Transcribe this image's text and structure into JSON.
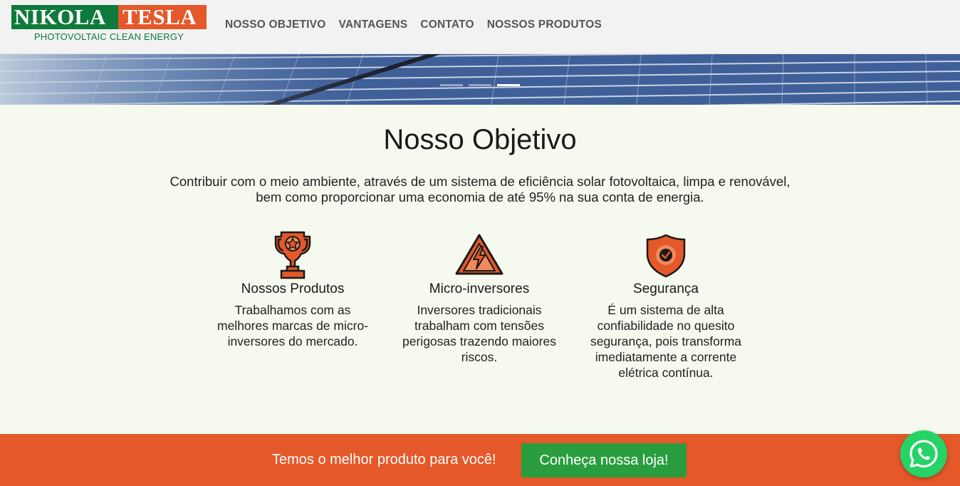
{
  "logo": {
    "name_left": "NIKOLA",
    "name_right": "TESLA",
    "tagline": "PHOTOVOLTAIC CLEAN ENERGY",
    "colors": {
      "green": "#0e7a3b",
      "orange": "#e4582a"
    }
  },
  "nav": {
    "items": [
      {
        "label": "NOSSO OBJETIVO"
      },
      {
        "label": "VANTAGENS"
      },
      {
        "label": "CONTATO"
      },
      {
        "label": "NOSSOS PRODUTOS"
      }
    ]
  },
  "hero": {
    "image": "solar-panels-banner",
    "slides": 3,
    "active_slide": 3
  },
  "main": {
    "title": "Nosso Objetivo",
    "intro_line1": "Contribuir com o meio ambiente, através de um sistema de eficiência solar fotovoltaica, limpa e renovável,",
    "intro_line2": "bem como proporcionar uma economia de até 95% na sua conta de energia.",
    "features": [
      {
        "icon": "trophy-icon",
        "title": "Nossos Produtos",
        "text": "Trabalhamos com as melhores marcas de micro-inversores do mercado."
      },
      {
        "icon": "high-voltage-warning-icon",
        "title": "Micro-inversores",
        "text": "Inversores tradicionais trabalham com tensões perigosas trazendo maiores riscos."
      },
      {
        "icon": "shield-check-icon",
        "title": "Segurança",
        "text": "É um sistema de alta confiabilidade no quesito segurança, pois transforma imediatamente a corrente elétrica contínua."
      }
    ]
  },
  "cta": {
    "text": "Temos o melhor produto para você!",
    "button_label": "Conheça nossa loja!",
    "colors": {
      "bar": "#e4582a",
      "button": "#2a9d3e"
    }
  },
  "whatsapp": {
    "icon": "whatsapp-icon",
    "color": "#25d366"
  }
}
